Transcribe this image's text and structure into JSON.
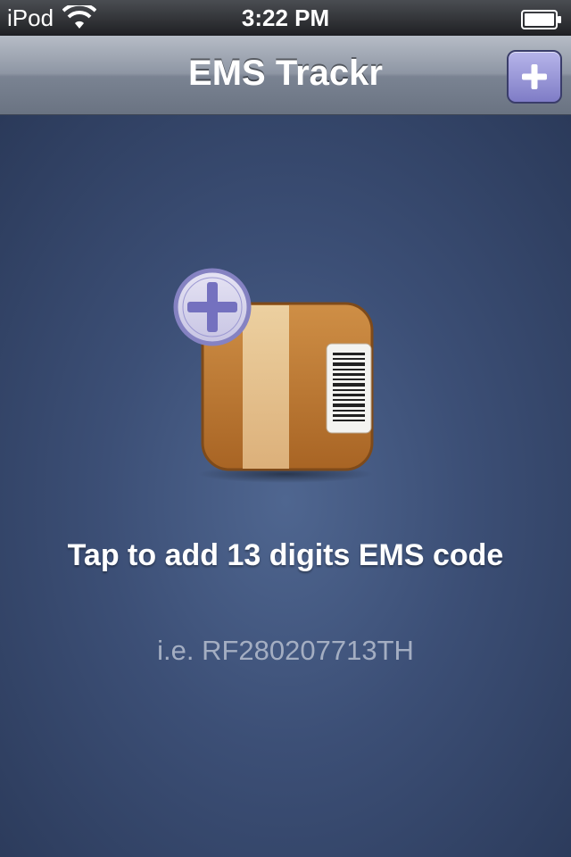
{
  "status_bar": {
    "carrier": "iPod",
    "time": "3:22 PM",
    "icons": [
      "wifi-icon",
      "battery-icon"
    ]
  },
  "nav": {
    "title": "EMS Trackr",
    "add_button_icon": "plus-icon"
  },
  "main": {
    "prompt": "Tap to add 13 digits EMS code",
    "example": "i.e. RF280207713TH",
    "illustration_icon": "package-with-barcode-icon",
    "badge_icon": "plus-icon"
  },
  "colors": {
    "nav_title": "#ffffff",
    "accent_button": "#8f8cd6",
    "background": "#3c4f76",
    "example_text": "#a4aec2"
  }
}
